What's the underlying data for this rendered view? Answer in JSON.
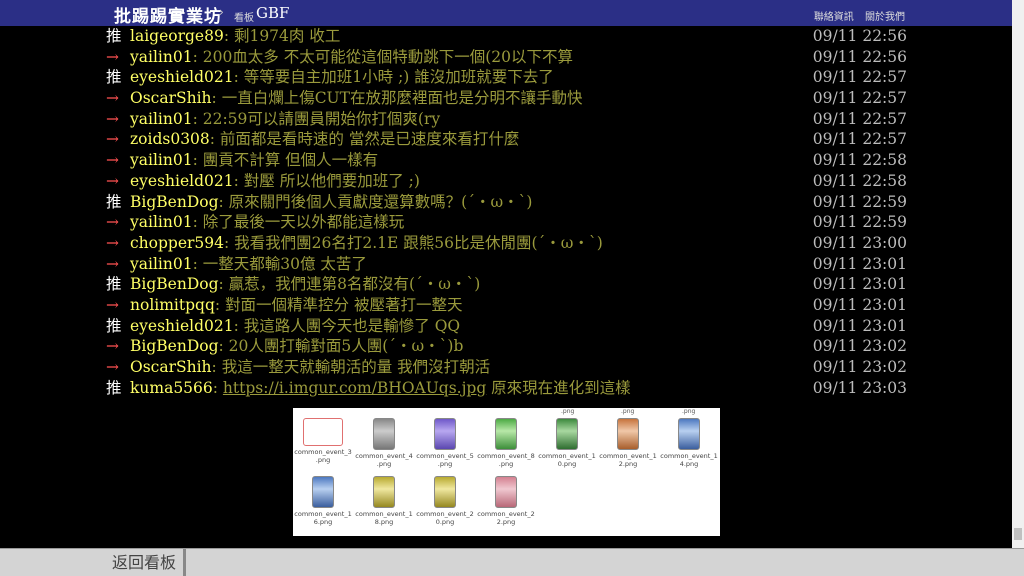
{
  "header": {
    "site_name": "批踢踢實業坊",
    "separator": "›",
    "board_label": "看板",
    "board_name": "GBF",
    "links": [
      "聯絡資訊",
      "關於我們"
    ]
  },
  "comments": [
    {
      "tag": "推",
      "type": "push",
      "user": "laigeorge89",
      "text": ": 剩1974肉 收工",
      "time": "09/11 22:56"
    },
    {
      "tag": "→",
      "type": "arrow",
      "user": "yailin01",
      "text": ": 200血太多 不太可能從這個特動跳下一個(20以下不算",
      "time": "09/11 22:56"
    },
    {
      "tag": "推",
      "type": "push",
      "user": "eyeshield021",
      "text": ": 等等要自主加班1小時 ;) 誰沒加班就要下去了",
      "time": "09/11 22:57"
    },
    {
      "tag": "→",
      "type": "arrow",
      "user": "OscarShih",
      "text": ": 一直白爛上傷CUT在放那麼裡面也是分明不讓手動快",
      "time": "09/11 22:57"
    },
    {
      "tag": "→",
      "type": "arrow",
      "user": "yailin01",
      "text": ": 22:59可以請團員開始你打個爽(ry",
      "time": "09/11 22:57"
    },
    {
      "tag": "→",
      "type": "arrow",
      "user": "zoids0308",
      "text": ": 前面都是看時速的 當然是已速度來看打什麼",
      "time": "09/11 22:57"
    },
    {
      "tag": "→",
      "type": "arrow",
      "user": "yailin01",
      "text": ": 團貢不計算 但個人一樣有",
      "time": "09/11 22:58"
    },
    {
      "tag": "→",
      "type": "arrow",
      "user": "eyeshield021",
      "text": ": 對壓 所以他們要加班了 ;)",
      "time": "09/11 22:58"
    },
    {
      "tag": "推",
      "type": "push",
      "user": "BigBenDog",
      "text": ": 原來關門後個人貢獻度還算數嗎？(´・ω・`)",
      "time": "09/11 22:59"
    },
    {
      "tag": "→",
      "type": "arrow",
      "user": "yailin01",
      "text": ": 除了最後一天以外都能這樣玩",
      "time": "09/11 22:59"
    },
    {
      "tag": "→",
      "type": "arrow",
      "user": "chopper594",
      "text": ": 我看我們團26名打2.1E 跟熊56比是休閒團(´・ω・`)",
      "time": "09/11 23:00"
    },
    {
      "tag": "→",
      "type": "arrow",
      "user": "yailin01",
      "text": ": 一整天都輸30億 太苦了",
      "time": "09/11 23:01"
    },
    {
      "tag": "推",
      "type": "push",
      "user": "BigBenDog",
      "text": ": 贏惹，我們連第8名都沒有(´・ω・`)",
      "time": "09/11 23:01"
    },
    {
      "tag": "→",
      "type": "arrow",
      "user": "nolimitpqq",
      "text": ": 對面一個精準控分 被壓著打一整天",
      "time": "09/11 23:01"
    },
    {
      "tag": "推",
      "type": "push",
      "user": "eyeshield021",
      "text": ": 我這路人團今天也是輸慘了 QQ",
      "time": "09/11 23:01"
    },
    {
      "tag": "→",
      "type": "arrow",
      "user": "BigBenDog",
      "text": ": 20人團打輸對面5人團(´・ω・`)b",
      "time": "09/11 23:02"
    },
    {
      "tag": "→",
      "type": "arrow",
      "user": "OscarShih",
      "text": ": 我這一整天就輸朝活的量 我們沒打朝活",
      "time": "09/11 23:02"
    },
    {
      "tag": "推",
      "type": "push",
      "user": "kuma5566",
      "text_pre": ": ",
      "link": "https://i.imgur.com/BHOAUqs.jpg",
      "text": " 原來現在進化到這樣",
      "time": "09/11 23:03"
    }
  ],
  "embedded_image": {
    "top_fragments": [
      ".png",
      ".png",
      ".png"
    ],
    "files": [
      {
        "name": "common_event_3\n.png",
        "color": "red"
      },
      {
        "name": "common_event_4\n.png",
        "color": "gray"
      },
      {
        "name": "common_event_5\n.png",
        "color": "purple"
      },
      {
        "name": "common_event_8\n.png",
        "color": "green"
      },
      {
        "name": "common_event_1\n0.png",
        "color": "darkgreen"
      },
      {
        "name": "common_event_1\n2.png",
        "color": "orange"
      },
      {
        "name": "common_event_1\n4.png",
        "color": "blue"
      },
      {
        "name": "common_event_1\n6.png",
        "color": "blue"
      },
      {
        "name": "common_event_1\n8.png",
        "color": "yellow"
      },
      {
        "name": "common_event_2\n0.png",
        "color": "yellow"
      },
      {
        "name": "common_event_2\n2.png",
        "color": "pink"
      }
    ]
  },
  "footer": {
    "back_label": "返回看板"
  }
}
